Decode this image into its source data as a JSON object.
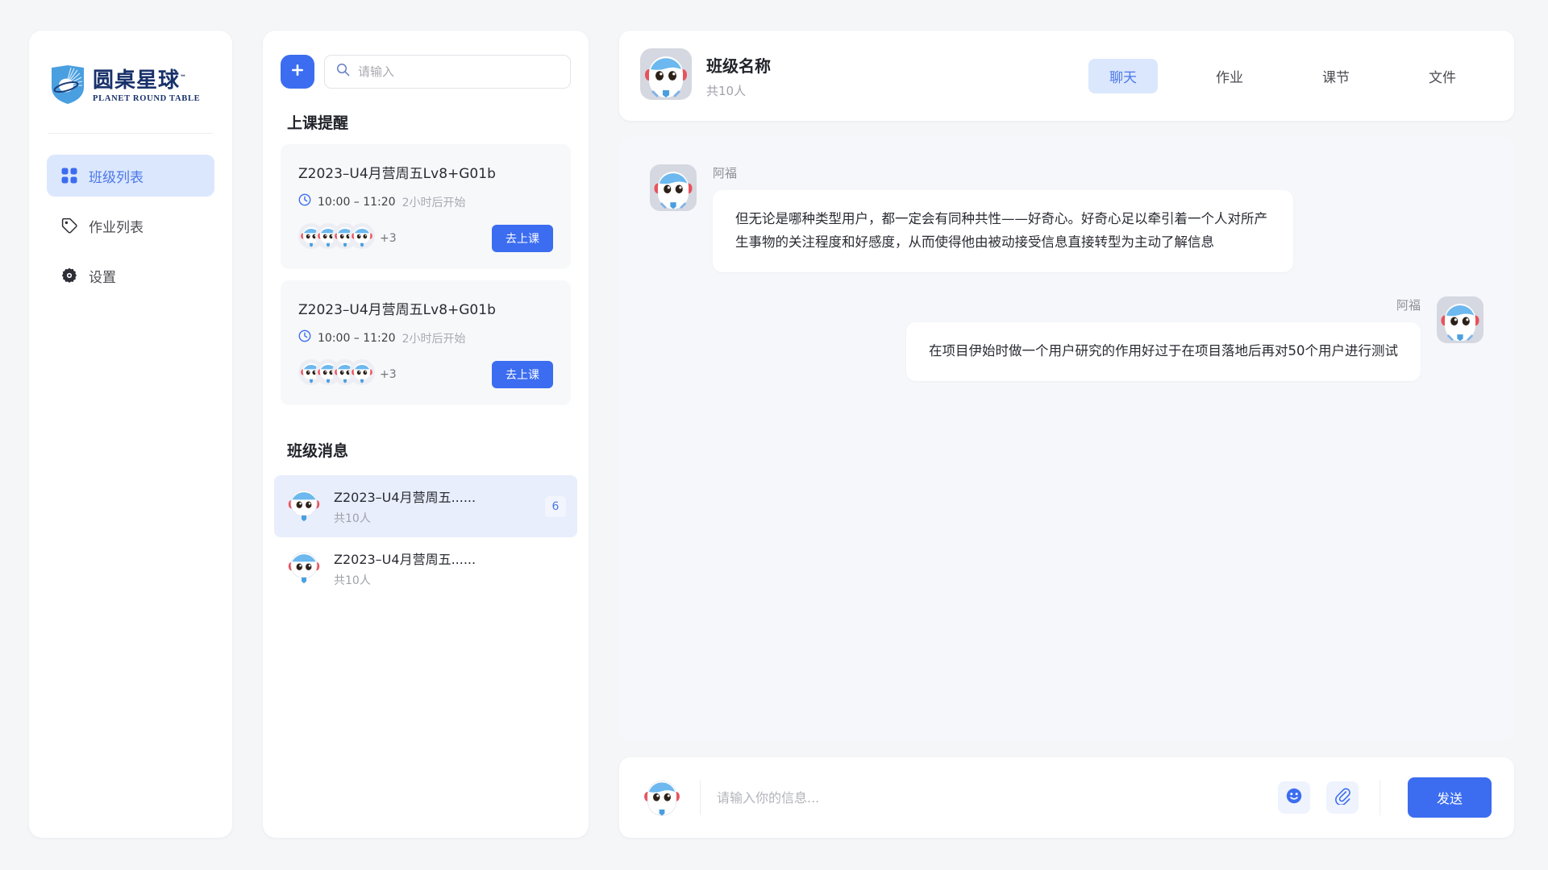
{
  "brand": {
    "name_cn": "圆桌星球",
    "name_en": "PLANET ROUND TABLE",
    "trademark": "™",
    "accent": "#3c6df0",
    "brand_navy": "#18316b"
  },
  "sidebar": {
    "items": [
      {
        "label": "班级列表",
        "icon": "grid-icon",
        "active": true
      },
      {
        "label": "作业列表",
        "icon": "tag-icon",
        "active": false
      },
      {
        "label": "设置",
        "icon": "gear-icon",
        "active": false
      }
    ]
  },
  "midcol": {
    "add_button_icon": "plus-icon",
    "search": {
      "placeholder": "请输入",
      "value": "",
      "icon": "search-icon"
    },
    "reminder_section_title": "上课提醒",
    "reminders": [
      {
        "title": "Z2023–U4月营周五Lv8+G01b",
        "time": "10:00 – 11:20",
        "countdown": "2小时后开始",
        "avatar_count": 4,
        "extra_count": "+3",
        "action_label": "去上课",
        "clock_icon": "clock-icon"
      },
      {
        "title": "Z2023–U4月营周五Lv8+G01b",
        "time": "10:00 – 11:20",
        "countdown": "2小时后开始",
        "avatar_count": 4,
        "extra_count": "+3",
        "action_label": "去上课",
        "clock_icon": "clock-icon"
      }
    ],
    "messages_section_title": "班级消息",
    "messages": [
      {
        "name": "Z2023–U4月营周五......",
        "members": "共10人",
        "badge": "6",
        "selected": true
      },
      {
        "name": "Z2023–U4月营周五......",
        "members": "共10人",
        "badge": "",
        "selected": false
      }
    ]
  },
  "chat": {
    "header": {
      "avatar": "robot-avatar",
      "title": "班级名称",
      "members": "共10人"
    },
    "tabs": [
      {
        "label": "聊天",
        "active": true
      },
      {
        "label": "作业",
        "active": false
      },
      {
        "label": "课节",
        "active": false
      },
      {
        "label": "文件",
        "active": false
      }
    ],
    "messages": [
      {
        "sender": "阿福",
        "direction": "in",
        "text": "但无论是哪种类型用户，都一定会有同种共性——好奇心。好奇心足以牵引着一个人对所产生事物的关注程度和好感度，从而使得他由被动接受信息直接转型为主动了解信息"
      },
      {
        "sender": "阿福",
        "direction": "out",
        "text": "在项目伊始时做一个用户研究的作用好过于在项目落地后再对50个用户进行测试"
      }
    ],
    "composer": {
      "avatar": "robot-avatar",
      "placeholder": "请输入你的信息...",
      "value": "",
      "emoji_icon": "emoji-smiley-icon",
      "attach_icon": "paperclip-icon",
      "send_label": "发送"
    }
  }
}
